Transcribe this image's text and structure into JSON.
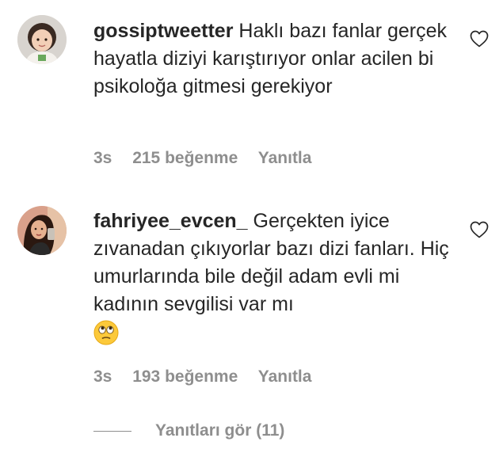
{
  "comments": [
    {
      "username": "gossiptweetter",
      "text": "Haklı bazı fanlar gerçek hayatla diziyi karıştırıyor onlar acilen bi psikoloğa gitmesi gerekiyor",
      "time": "3s",
      "likes": "215 beğenme",
      "reply": "Yanıtla",
      "avatar_icon": "child-avatar"
    },
    {
      "username": "fahriyee_evcen_",
      "text": "Gerçekten iyice zıvanadan çıkıyorlar bazı dizi fanları. Hiç umurlarında bile değil adam evli mi kadının sevgilisi var mı",
      "emoji": "face-with-rolling-eyes-emoji",
      "time": "3s",
      "likes": "193 beğenme",
      "reply": "Yanıtla",
      "avatar_icon": "woman-selfie-avatar"
    }
  ],
  "view_replies": "Yanıtları gör (11)",
  "icons": {
    "like": "heart-outline-icon"
  },
  "colors": {
    "text": "#262626",
    "meta": "#8e8e8e"
  }
}
